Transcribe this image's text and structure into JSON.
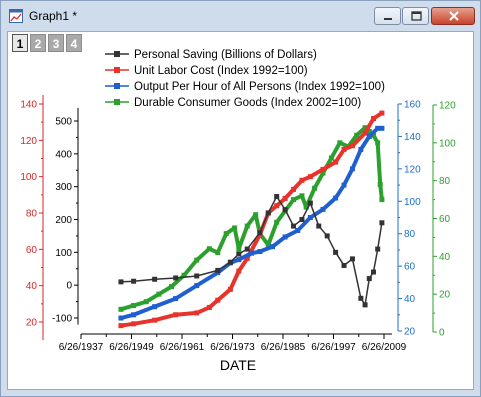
{
  "window": {
    "title": "Graph1 *"
  },
  "layer_tabs": [
    "1",
    "2",
    "3",
    "4"
  ],
  "chart_data": {
    "type": "line",
    "xlabel": "DATE",
    "x_ticks": [
      "6/26/1937",
      "6/26/1949",
      "6/26/1961",
      "6/26/1973",
      "6/26/1985",
      "6/26/1997",
      "6/26/2009"
    ],
    "axes": [
      {
        "side": "left",
        "color": "#d62728",
        "ticks": [
          20,
          40,
          60,
          80,
          100,
          120,
          140
        ],
        "range": [
          10,
          145
        ]
      },
      {
        "side": "left",
        "color": "#000000",
        "ticks": [
          -100,
          0,
          100,
          200,
          300,
          400,
          500
        ],
        "range": [
          -120,
          540
        ]
      },
      {
        "side": "right",
        "color": "#1f6fc7",
        "ticks": [
          20,
          40,
          60,
          80,
          100,
          120,
          140,
          160
        ],
        "range": [
          20,
          160
        ]
      },
      {
        "side": "right",
        "color": "#2ca02c",
        "ticks": [
          0,
          20,
          40,
          60,
          80,
          100,
          120
        ],
        "range": [
          0,
          120
        ]
      }
    ],
    "series": [
      {
        "name": "Personal Saving (Billions of Dollars)",
        "color": "#333333",
        "axis": 1,
        "x": [
          1947,
          1950,
          1955,
          1960,
          1965,
          1970,
          1973,
          1975,
          1977,
          1980,
          1982,
          1984,
          1986,
          1988,
          1990,
          1992,
          1994,
          1996,
          1998,
          2000,
          2002,
          2004,
          2005,
          2006,
          2007,
          2008,
          2009
        ],
        "values": [
          10,
          12,
          18,
          22,
          28,
          45,
          70,
          95,
          110,
          160,
          220,
          270,
          230,
          180,
          200,
          250,
          180,
          150,
          100,
          60,
          80,
          -40,
          -60,
          20,
          40,
          110,
          190
        ]
      },
      {
        "name": "Unit Labor Cost (Index 1992=100)",
        "color": "#e8322c",
        "axis": 0,
        "x": [
          1947,
          1950,
          1955,
          1960,
          1965,
          1968,
          1970,
          1973,
          1975,
          1977,
          1980,
          1982,
          1984,
          1986,
          1988,
          1990,
          1992,
          1995,
          1998,
          2000,
          2002,
          2005,
          2007,
          2009
        ],
        "values": [
          18,
          19,
          21,
          24,
          25,
          28,
          32,
          38,
          48,
          55,
          68,
          80,
          84,
          88,
          93,
          98,
          100,
          104,
          108,
          115,
          117,
          124,
          132,
          135
        ]
      },
      {
        "name": "Output Per Hour of All Persons (Index 1992=100)",
        "color": "#1f5fd0",
        "axis": 2,
        "x": [
          1947,
          1950,
          1955,
          1960,
          1965,
          1970,
          1973,
          1975,
          1978,
          1980,
          1983,
          1986,
          1989,
          1992,
          1995,
          1998,
          2000,
          2002,
          2004,
          2006,
          2008,
          2009
        ],
        "values": [
          28,
          30,
          35,
          40,
          48,
          56,
          62,
          64,
          68,
          69,
          72,
          78,
          82,
          90,
          95,
          102,
          110,
          120,
          132,
          140,
          145,
          145
        ]
      },
      {
        "name": "Durable Consumer Goods (Index 2002=100)",
        "color": "#2ca02c",
        "axis": 3,
        "x": [
          1947,
          1950,
          1953,
          1956,
          1959,
          1962,
          1965,
          1968,
          1970,
          1972,
          1974,
          1975,
          1977,
          1979,
          1980,
          1982,
          1984,
          1986,
          1988,
          1990,
          1991,
          1993,
          1995,
          1997,
          1999,
          2001,
          2003,
          2005,
          2006,
          2007,
          2008,
          2008.6,
          2009
        ],
        "values": [
          12,
          14,
          16,
          20,
          24,
          30,
          38,
          44,
          42,
          52,
          55,
          44,
          56,
          62,
          52,
          46,
          58,
          64,
          70,
          72,
          66,
          76,
          84,
          92,
          100,
          98,
          104,
          108,
          106,
          104,
          100,
          78,
          70
        ]
      }
    ]
  }
}
